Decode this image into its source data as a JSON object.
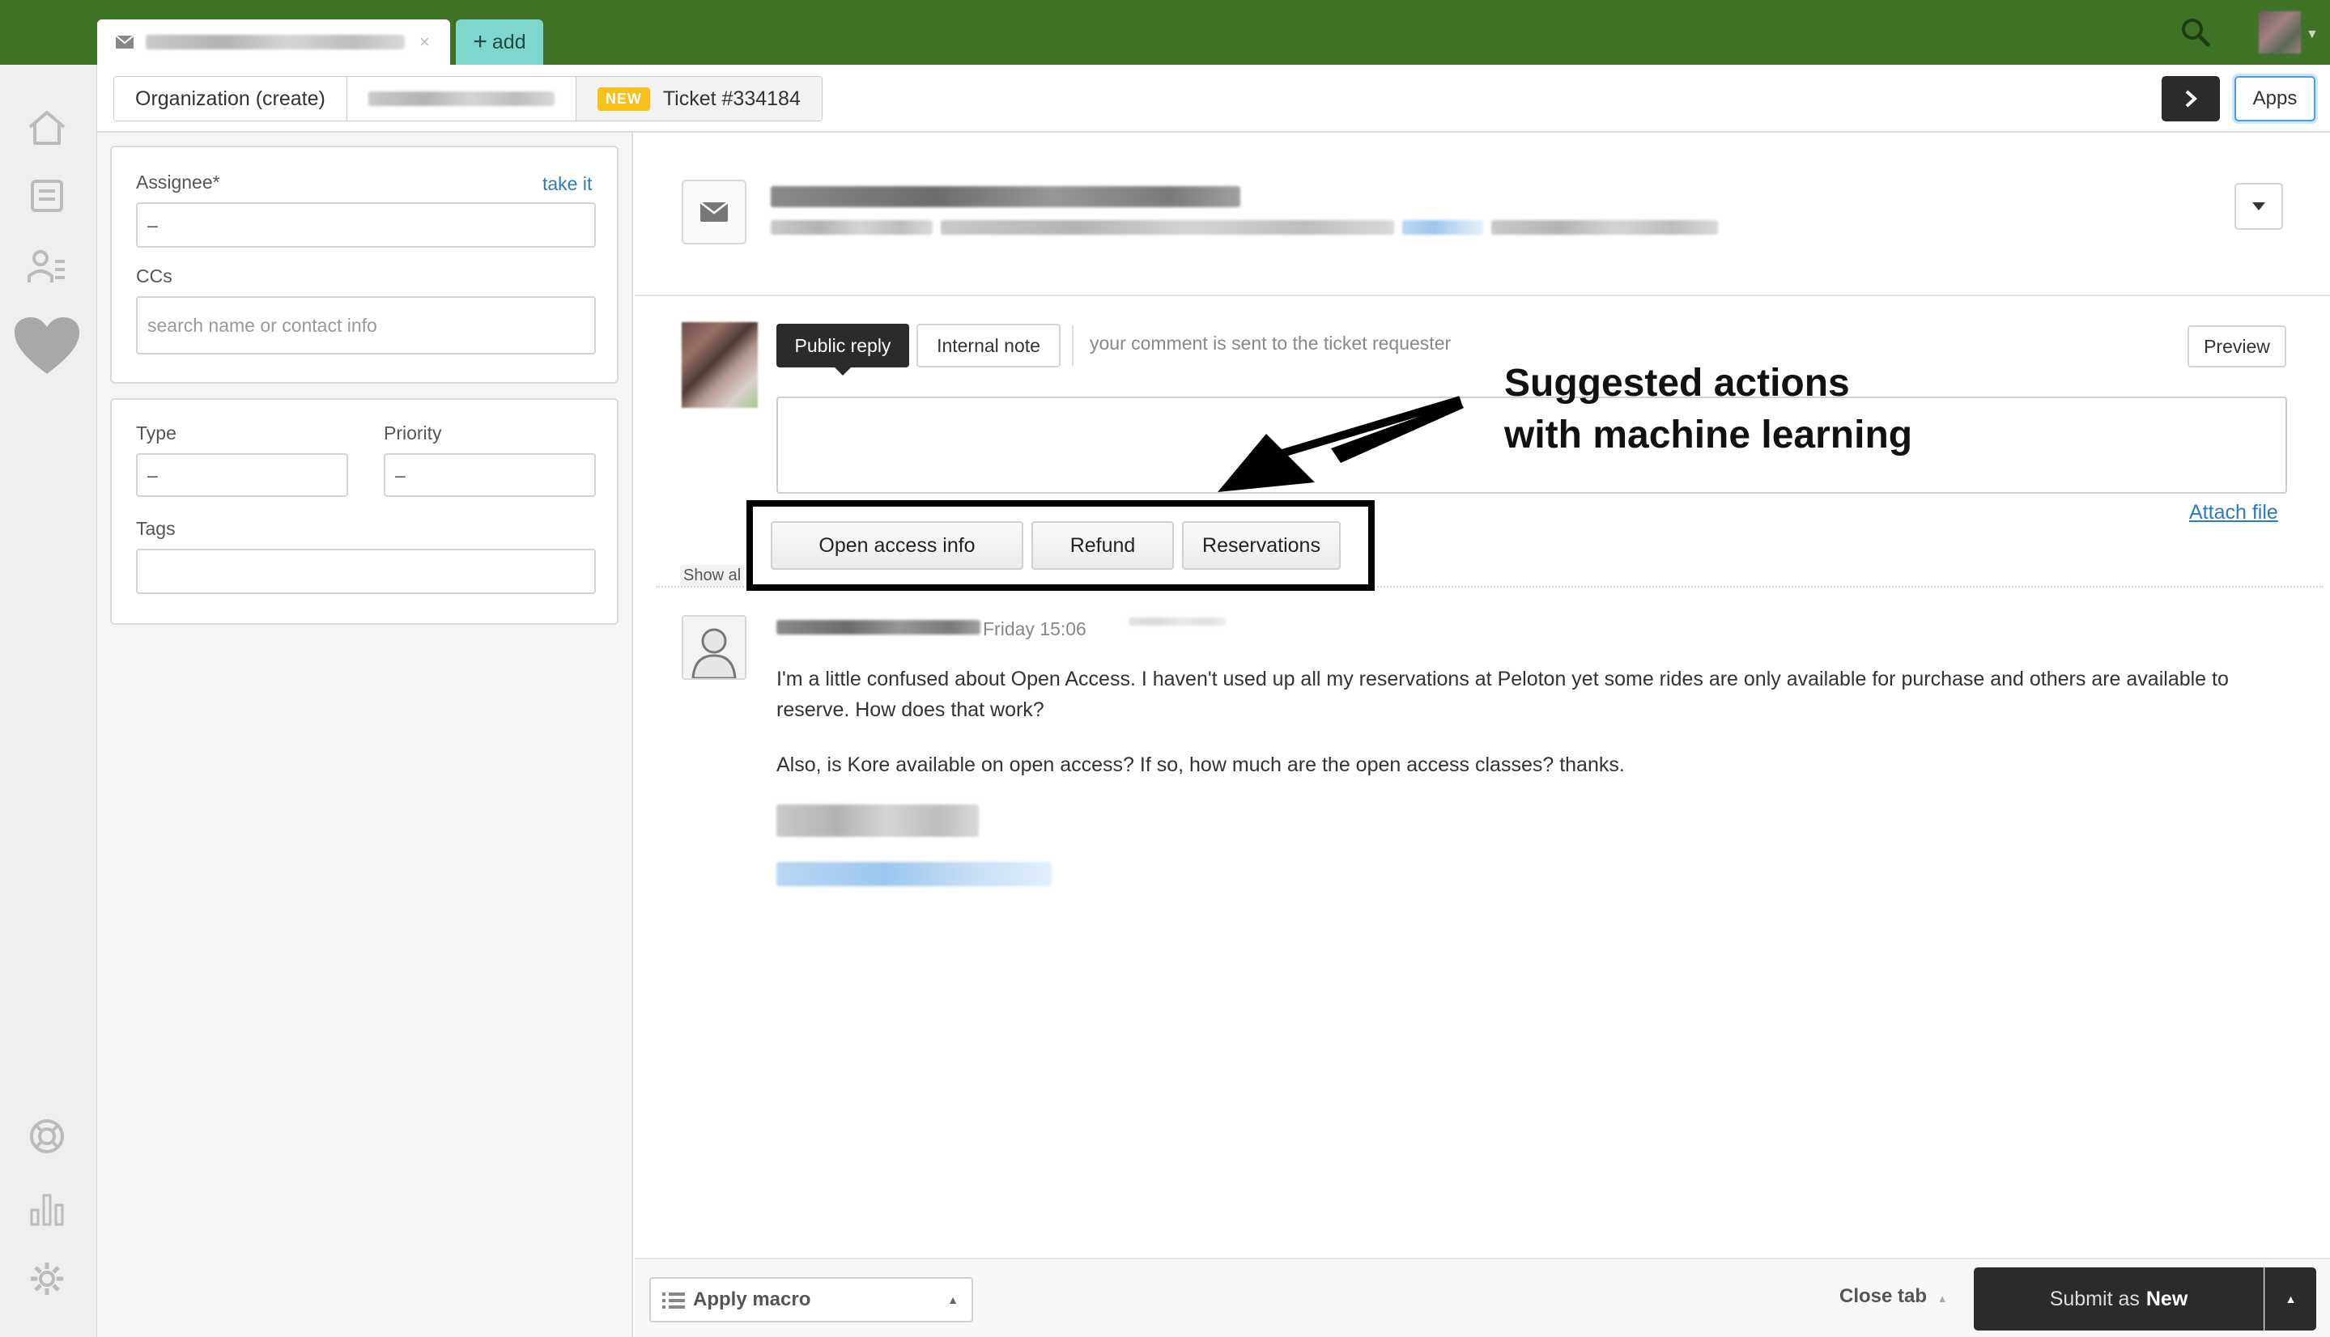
{
  "tabs": {
    "add_label": "add"
  },
  "breadcrumb": {
    "organization": "Organization (create)",
    "ticket_badge": "NEW",
    "ticket": "Ticket #334184"
  },
  "header": {
    "apps_label": "Apps"
  },
  "sidebar": {
    "assignee_label": "Assignee*",
    "take_it": "take it",
    "assignee_value": "–",
    "ccs_label": "CCs",
    "ccs_placeholder": "search name or contact info",
    "type_label": "Type",
    "type_value": "–",
    "priority_label": "Priority",
    "priority_value": "–",
    "tags_label": "Tags",
    "tags_value": ""
  },
  "reply": {
    "public_reply": "Public reply",
    "internal_note": "Internal note",
    "hint": "your comment is sent to the ticket requester",
    "preview": "Preview",
    "attach_file": "Attach file"
  },
  "annotation": {
    "line1": "Suggested actions",
    "line2": "with machine learning"
  },
  "suggestions": [
    "Open access info",
    "Refund",
    "Reservations"
  ],
  "conversation": {
    "show_all": "Show al",
    "time": "Friday 15:06",
    "paragraph1": "I'm a little confused about Open Access. I haven't used up all my reservations at Peloton yet some rides are only available for purchase and others are available to reserve. How does that work?",
    "paragraph2": "Also, is Kore available on open access? If so, how much are the open access classes? thanks."
  },
  "footer": {
    "apply_macro": "Apply macro",
    "close_tab": "Close tab",
    "submit_prefix": "Submit as",
    "submit_status": "New"
  },
  "colors": {
    "topbar": "#3e7327",
    "accent_teal": "#7fd6cc",
    "new_badge": "#f8c11a",
    "link": "#2d7bbd",
    "dark_button": "#2b2b2b"
  }
}
